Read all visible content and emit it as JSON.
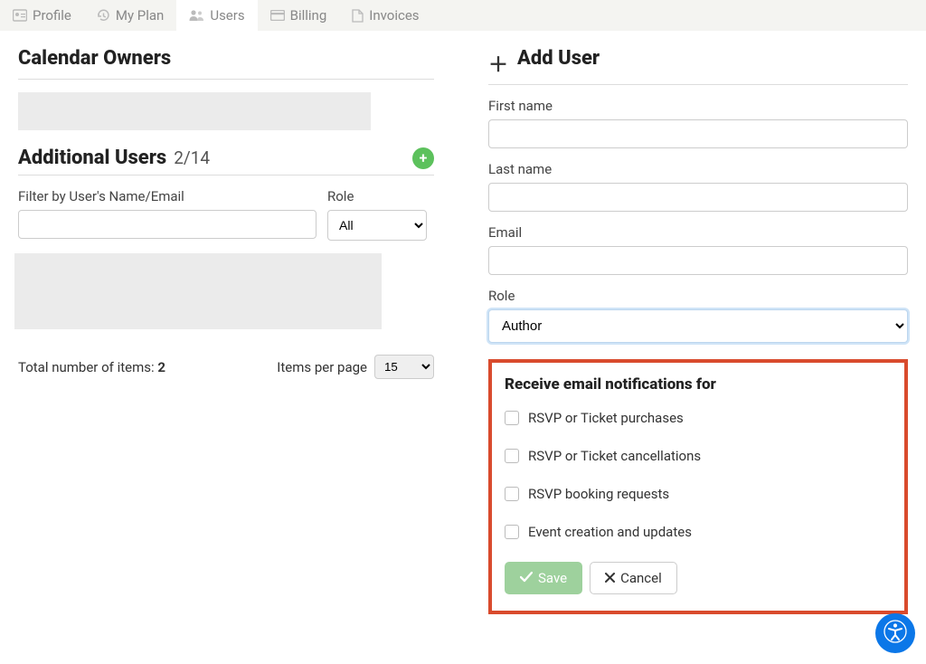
{
  "tabs": [
    {
      "label": "Profile"
    },
    {
      "label": "My Plan"
    },
    {
      "label": "Users"
    },
    {
      "label": "Billing"
    },
    {
      "label": "Invoices"
    }
  ],
  "left": {
    "calendar_owners_title": "Calendar Owners",
    "additional_users_title": "Additional Users",
    "users_count": "2/14",
    "filter_name_label": "Filter by User's Name/Email",
    "filter_role_label": "Role",
    "role_options": [
      "All"
    ],
    "role_selected": "All",
    "totals_label": "Total number of items: ",
    "totals_value": "2",
    "ipp_label": "Items per page",
    "ipp_selected": "15"
  },
  "right": {
    "add_user_title": "Add User",
    "first_name_label": "First name",
    "last_name_label": "Last name",
    "email_label": "Email",
    "role_label": "Role",
    "role_selected": "Author",
    "notif_title": "Receive email notifications for",
    "notif_items": [
      "RSVP or Ticket purchases",
      "RSVP or Ticket cancellations",
      "RSVP booking requests",
      "Event creation and updates"
    ],
    "save_label": "Save",
    "cancel_label": "Cancel"
  }
}
